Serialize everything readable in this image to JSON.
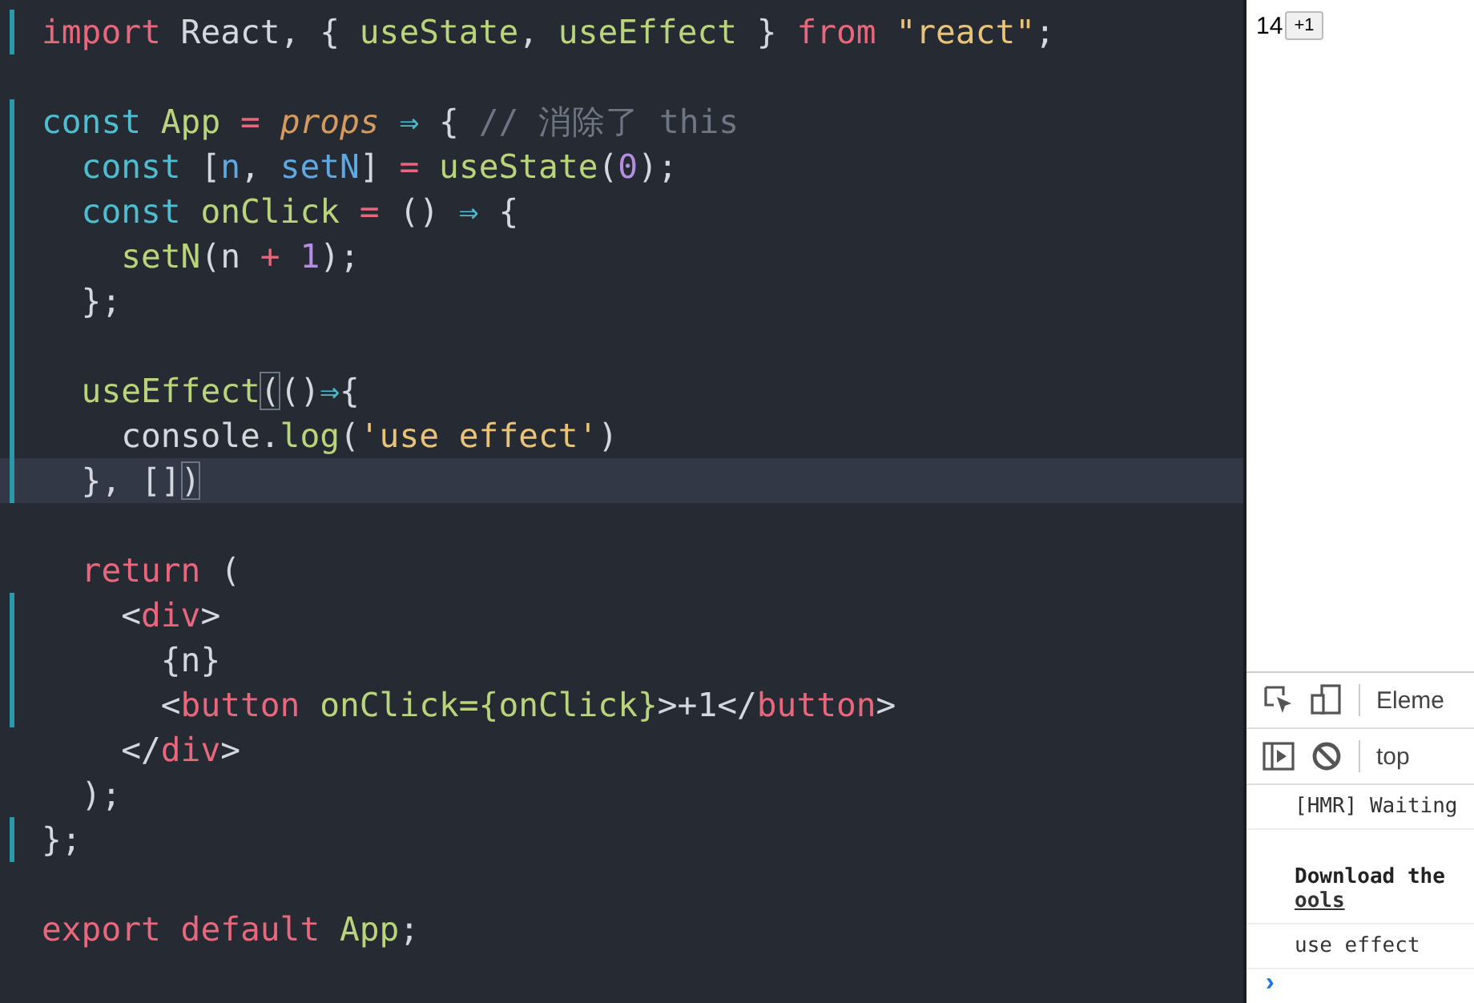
{
  "editor": {
    "lines": [
      {
        "modified": true,
        "current": false,
        "tokens": [
          {
            "kind": "keyword",
            "text": "import"
          },
          {
            "kind": "plain",
            "text": " React, { "
          },
          {
            "kind": "func",
            "text": "useState"
          },
          {
            "kind": "plain",
            "text": ", "
          },
          {
            "kind": "func",
            "text": "useEffect"
          },
          {
            "kind": "plain",
            "text": " } "
          },
          {
            "kind": "keyword",
            "text": "from"
          },
          {
            "kind": "string",
            "text": " \"react\""
          },
          {
            "kind": "plain",
            "text": ";"
          }
        ]
      },
      {
        "modified": false,
        "current": false
      },
      {
        "modified": true,
        "current": false,
        "tokens": [
          {
            "kind": "storage",
            "text": "const"
          },
          {
            "kind": "func",
            "text": " App"
          },
          {
            "kind": "keyword",
            "text": " ="
          },
          {
            "kind": "param",
            "text": " props"
          },
          {
            "kind": "storage",
            "text": " ⇒"
          },
          {
            "kind": "plain",
            "text": " { "
          },
          {
            "kind": "comment",
            "text": "// 消除了 this"
          }
        ]
      },
      {
        "modified": true,
        "current": false,
        "tokens": [
          {
            "kind": "storage",
            "text": "  const"
          },
          {
            "kind": "plain",
            "text": " ["
          },
          {
            "kind": "variable",
            "text": "n"
          },
          {
            "kind": "plain",
            "text": ", "
          },
          {
            "kind": "variable",
            "text": "setN"
          },
          {
            "kind": "plain",
            "text": "] "
          },
          {
            "kind": "keyword",
            "text": "="
          },
          {
            "kind": "func",
            "text": " useState"
          },
          {
            "kind": "plain",
            "text": "("
          },
          {
            "kind": "number",
            "text": "0"
          },
          {
            "kind": "plain",
            "text": ");"
          }
        ]
      },
      {
        "modified": true,
        "current": false,
        "tokens": [
          {
            "kind": "storage",
            "text": "  const"
          },
          {
            "kind": "func",
            "text": " onClick"
          },
          {
            "kind": "keyword",
            "text": " ="
          },
          {
            "kind": "plain",
            "text": " () "
          },
          {
            "kind": "storage",
            "text": "⇒"
          },
          {
            "kind": "plain",
            "text": " {"
          }
        ]
      },
      {
        "modified": true,
        "current": false,
        "tokens": [
          {
            "kind": "func",
            "text": "    setN"
          },
          {
            "kind": "plain",
            "text": "(n "
          },
          {
            "kind": "keyword",
            "text": "+"
          },
          {
            "kind": "number",
            "text": " 1"
          },
          {
            "kind": "plain",
            "text": ");"
          }
        ]
      },
      {
        "modified": true,
        "current": false,
        "tokens": [
          {
            "kind": "plain",
            "text": "  };"
          }
        ]
      },
      {
        "modified": true,
        "current": false
      },
      {
        "modified": true,
        "current": false,
        "tokens": [
          {
            "kind": "func",
            "text": "  useEffect"
          },
          {
            "kind": "match",
            "text": "("
          },
          {
            "kind": "plain",
            "text": "()"
          },
          {
            "kind": "storage",
            "text": "⇒"
          },
          {
            "kind": "plain",
            "text": "{"
          }
        ]
      },
      {
        "modified": true,
        "current": false,
        "tokens": [
          {
            "kind": "plain",
            "text": "    console."
          },
          {
            "kind": "func",
            "text": "log"
          },
          {
            "kind": "plain",
            "text": "("
          },
          {
            "kind": "string",
            "text": "'use effect'"
          },
          {
            "kind": "plain",
            "text": ")"
          }
        ]
      },
      {
        "modified": true,
        "current": true,
        "tokens": [
          {
            "kind": "plain",
            "text": "  }, []"
          },
          {
            "kind": "match",
            "text": ")"
          }
        ]
      },
      {
        "modified": false,
        "current": false
      },
      {
        "modified": false,
        "current": false,
        "tokens": [
          {
            "kind": "keyword",
            "text": "  return"
          },
          {
            "kind": "plain",
            "text": " ("
          }
        ]
      },
      {
        "modified": true,
        "current": false,
        "tokens": [
          {
            "kind": "plain",
            "text": "    <"
          },
          {
            "kind": "keyword",
            "text": "div"
          },
          {
            "kind": "plain",
            "text": ">"
          }
        ]
      },
      {
        "modified": true,
        "current": false,
        "tokens": [
          {
            "kind": "plain",
            "text": "      {n}"
          }
        ]
      },
      {
        "modified": true,
        "current": false,
        "tokens": [
          {
            "kind": "plain",
            "text": "      <"
          },
          {
            "kind": "keyword",
            "text": "button"
          },
          {
            "kind": "func",
            "text": " onClick={onClick}"
          },
          {
            "kind": "plain",
            "text": ">+1</"
          },
          {
            "kind": "keyword",
            "text": "button"
          },
          {
            "kind": "plain",
            "text": ">"
          }
        ]
      },
      {
        "modified": false,
        "current": false,
        "tokens": [
          {
            "kind": "plain",
            "text": "    </"
          },
          {
            "kind": "keyword",
            "text": "div"
          },
          {
            "kind": "plain",
            "text": ">"
          }
        ]
      },
      {
        "modified": false,
        "current": false,
        "tokens": [
          {
            "kind": "plain",
            "text": "  );"
          }
        ]
      },
      {
        "modified": true,
        "current": false,
        "tokens": [
          {
            "kind": "plain",
            "text": "};"
          }
        ]
      },
      {
        "modified": false,
        "current": false
      },
      {
        "modified": false,
        "current": false,
        "tokens": [
          {
            "kind": "keyword",
            "text": "export"
          },
          {
            "kind": "keyword",
            "text": " default"
          },
          {
            "kind": "func",
            "text": " App"
          },
          {
            "kind": "plain",
            "text": ";"
          }
        ]
      }
    ]
  },
  "preview": {
    "count": "14",
    "button": "+1"
  },
  "devtools": {
    "tab": "Eleme",
    "context": "top",
    "console": [
      {
        "kind": "log",
        "text": "[HMR] Waiting"
      },
      {
        "kind": "notice",
        "text": "Download the",
        "link": "ools"
      },
      {
        "kind": "log",
        "text": "use effect"
      }
    ],
    "prompt": "›"
  }
}
